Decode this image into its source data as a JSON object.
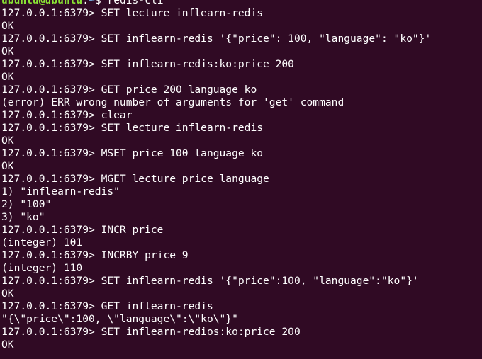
{
  "shell_prompt": {
    "user_host": "ubuntu@ubuntu",
    "colon": ":",
    "path": "~",
    "symbol": "$ ",
    "command": "redis-cli"
  },
  "lines": [
    "127.0.0.1:6379> SET lecture inflearn-redis",
    "OK",
    "127.0.0.1:6379> SET inflearn-redis '{\"price\": 100, \"language\": \"ko\"}'",
    "OK",
    "127.0.0.1:6379> SET inflearn-redis:ko:price 200",
    "OK",
    "127.0.0.1:6379> GET price 200 language ko",
    "(error) ERR wrong number of arguments for 'get' command",
    "127.0.0.1:6379> clear",
    "127.0.0.1:6379> SET lecture inflearn-redis",
    "OK",
    "127.0.0.1:6379> MSET price 100 language ko",
    "OK",
    "127.0.0.1:6379> MGET lecture price language",
    "1) \"inflearn-redis\"",
    "2) \"100\"",
    "3) \"ko\"",
    "127.0.0.1:6379> INCR price",
    "(integer) 101",
    "127.0.0.1:6379> INCRBY price 9",
    "(integer) 110",
    "127.0.0.1:6379> SET inflearn-redis '{\"price\":100, \"language\":\"ko\"}'",
    "OK",
    "127.0.0.1:6379> GET inflearn-redis",
    "\"{\\\"price\\\":100, \\\"language\\\":\\\"ko\\\"}\"",
    "127.0.0.1:6379> SET inflearn-redios:ko:price 200",
    "OK"
  ],
  "colors": {
    "background": "#300a24",
    "text": "#ffffff",
    "user_host": "#8ae234",
    "path": "#729fcf"
  }
}
